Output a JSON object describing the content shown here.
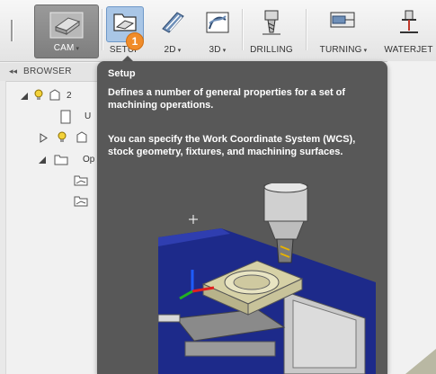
{
  "toolbar": {
    "cam_label": "CAM",
    "setup_label": "SETUP",
    "twod_label": "2D",
    "threed_label": "3D",
    "drilling_label": "DRILLING",
    "turning_label": "TURNING",
    "waterjet_label": "WATERJET",
    "badge_number": "1"
  },
  "browser": {
    "collapse_glyph": "◂◂",
    "title": "BROWSER",
    "rows": [
      {
        "label": "2"
      },
      {
        "label": "U"
      },
      {
        "label": ""
      },
      {
        "label": "Op"
      }
    ]
  },
  "tooltip": {
    "title": "Setup",
    "para1": "Defines a number of general properties for a set of machining operations.",
    "para2": "You can specify the Work Coordinate System (WCS), stock geometry, fixtures, and machining surfaces."
  },
  "colors": {
    "tooltip_bg": "#585858",
    "badge": "#f08c2a",
    "setup_highlight": "#a9c6e6"
  }
}
